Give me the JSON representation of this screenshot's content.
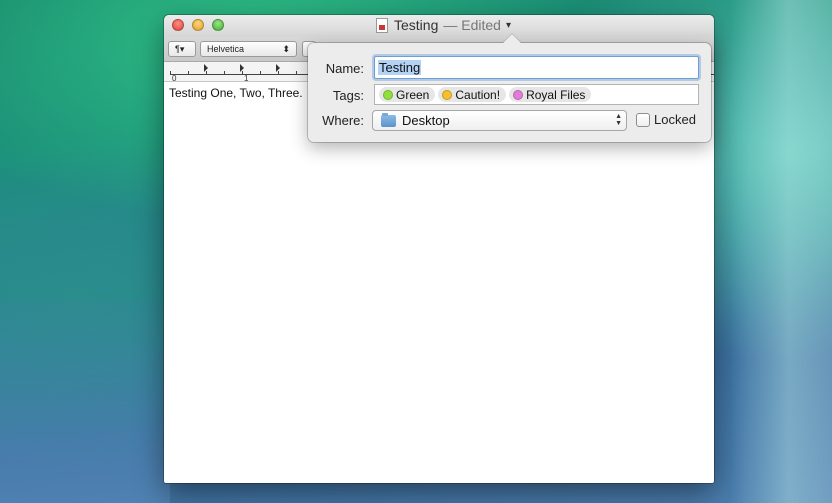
{
  "window": {
    "title": "Testing",
    "title_status": "— Edited",
    "caret": "▾"
  },
  "toolbar": {
    "paragraph_label": "¶▾",
    "font_name": "Helvetica",
    "font_updown": "⬍"
  },
  "ruler": {
    "labels": [
      "0",
      "1"
    ]
  },
  "document": {
    "text": "Testing One, Two, Three."
  },
  "popover": {
    "name_label": "Name:",
    "name_value": "Testing",
    "tags_label": "Tags:",
    "tags": [
      {
        "label": "Green",
        "color": "#8fe03a"
      },
      {
        "label": "Caution!",
        "color": "#f5c02a"
      },
      {
        "label": "Royal Files",
        "color": "#e57bd8"
      }
    ],
    "where_label": "Where:",
    "where_value": "Desktop",
    "locked_label": "Locked"
  },
  "colors": {
    "focus_ring": "#6c9fd6",
    "selection": "#b4d2f5"
  }
}
